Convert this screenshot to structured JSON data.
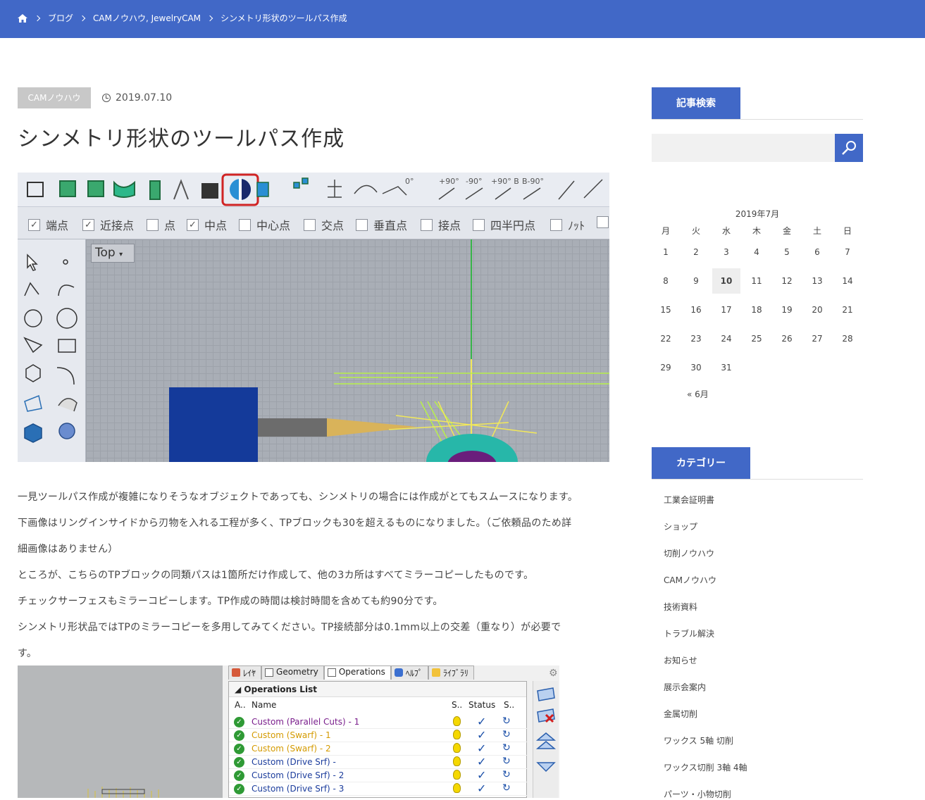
{
  "breadcrumb": {
    "home_icon": "home-icon",
    "items": [
      "ブログ",
      "CAMノウハウ, JewelryCAM",
      "シンメトリ形状のツールパス作成"
    ]
  },
  "post": {
    "category_badge": "CAMノウハウ",
    "date": "2019.07.10",
    "title": "シンメトリ形状のツールパス作成",
    "paragraphs": [
      "一見ツールパス作成が複雑になりそうなオブジェクトであっても、シンメトリの場合には作成がとてもスムースになります。",
      "下画像はリングインサイドから刃物を入れる工程が多く、TPブロックも30を超えるものになりました。（ご依頼品のため詳",
      "細画像はありません）",
      "ところが、こちらのTPブロックの同類パスは1箇所だけ作成して、他の3カ所はすべてミラーコピーしたものです。",
      "チェックサーフェスもミラーコピーします。TP作成の時間は検討時間を含めても約90分です。",
      "シンメトリ形状品ではTPのミラーコピーを多用してみてください。TP接続部分は0.1mm以上の交差（重なり）が必要で",
      "す。"
    ]
  },
  "screenshot1": {
    "snap_options": [
      {
        "label": "端点",
        "checked": true
      },
      {
        "label": "近接点",
        "checked": true
      },
      {
        "label": "点",
        "checked": false
      },
      {
        "label": "中点",
        "checked": true
      },
      {
        "label": "中心点",
        "checked": false
      },
      {
        "label": "交点",
        "checked": false
      },
      {
        "label": "垂直点",
        "checked": false
      },
      {
        "label": "接点",
        "checked": false
      },
      {
        "label": "四半円点",
        "checked": false
      },
      {
        "label": "ﾉｯﾄ",
        "checked": false
      }
    ],
    "viewport_label": "Top",
    "toolbar_texts": [
      "0°",
      "+90°",
      "-90°",
      "+90° B",
      "B-90°"
    ]
  },
  "screenshot2": {
    "tabs": [
      "ﾚｲﾔ",
      "Geometry",
      "Operations",
      "ﾍﾙﾌﾟ",
      "ﾗｲﾌﾞﾗﾘ"
    ],
    "list_title": "Operations List",
    "columns": [
      "A..",
      "Name",
      "S..",
      "Status",
      "S.."
    ],
    "rows": [
      {
        "name": "Custom (Parallel Cuts) - 1",
        "color": "#7a1e8c"
      },
      {
        "name": "Custom (Swarf) - 1",
        "color": "#d49a00"
      },
      {
        "name": "Custom (Swarf) - 2",
        "color": "#d49a00"
      },
      {
        "name": "Custom (Drive Srf) -",
        "color": "#1b3c9c"
      },
      {
        "name": "Custom (Drive Srf) - 2",
        "color": "#1b3c9c"
      },
      {
        "name": "Custom (Drive Srf) - 3",
        "color": "#1b3c9c"
      }
    ]
  },
  "sidebar": {
    "search_title": "記事検索",
    "calendar": {
      "caption": "2019年7月",
      "weekdays": [
        "月",
        "火",
        "水",
        "木",
        "金",
        "土",
        "日"
      ],
      "days": [
        "1",
        "2",
        "3",
        "4",
        "5",
        "6",
        "7",
        "8",
        "9",
        "10",
        "11",
        "12",
        "13",
        "14",
        "15",
        "16",
        "17",
        "18",
        "19",
        "20",
        "21",
        "22",
        "23",
        "24",
        "25",
        "26",
        "27",
        "28",
        "29",
        "30",
        "31"
      ],
      "today": "10",
      "prev_link": "« 6月"
    },
    "category_title": "カテゴリー",
    "categories": [
      "工業会証明書",
      "ショップ",
      "切削ノウハウ",
      "CAMノウハウ",
      "技術資料",
      "トラブル解決",
      "お知らせ",
      "展示会案内",
      "金属切削",
      "ワックス 5軸 切削",
      "ワックス切削 3軸 4軸",
      "パーツ・小物切削"
    ]
  }
}
